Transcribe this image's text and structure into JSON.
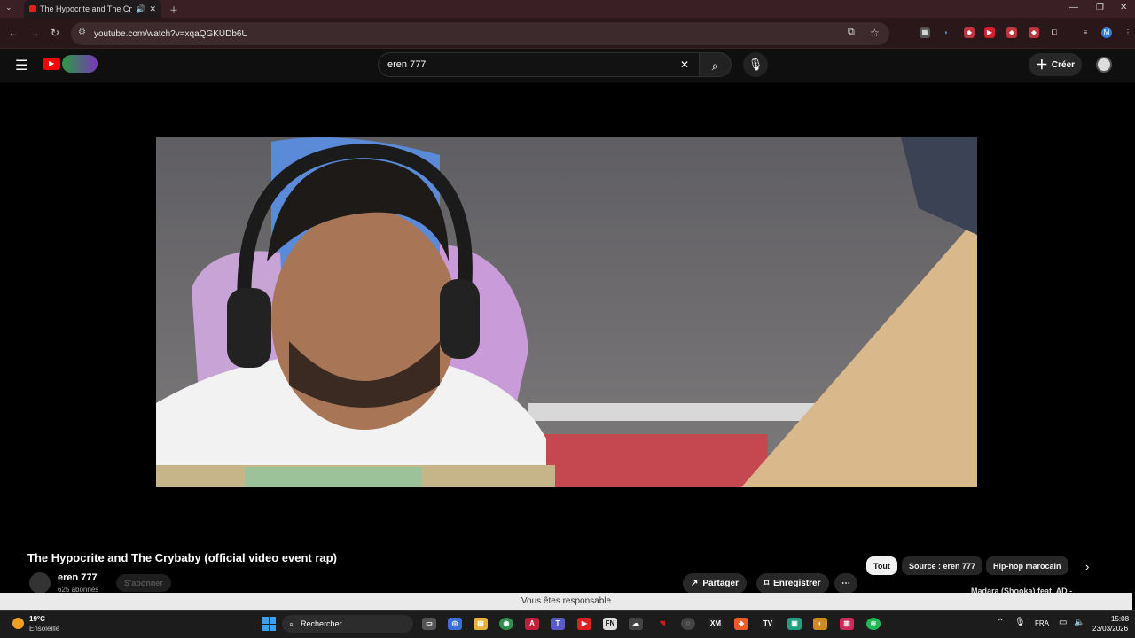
{
  "browser": {
    "tab_title": "The Hypocrite and The Cry",
    "url": "youtube.com/watch?v=xqaQGKUDb6U"
  },
  "youtube": {
    "search_value": "eren 777",
    "create_label": "Créer"
  },
  "video": {
    "title": "The Hypocrite and The Crybaby (official video event rap)",
    "channel_name": "eren 777",
    "subscribers": "625 abonnés",
    "subscribe_label": "S'abonner",
    "share_label": "Partager",
    "save_label": "Enregistrer"
  },
  "chips": [
    {
      "label": "Tout"
    },
    {
      "label": "Source : eren 777"
    },
    {
      "label": "Hip-hop marocain"
    }
  ],
  "next_video_peek": "Madara (Shooka) feat. AD -",
  "toast_text": "Vous êtes responsable",
  "taskbar": {
    "weather_temp": "19°C",
    "weather_desc": "Ensoleillé",
    "search_label": "Rechercher",
    "lang": "FRA",
    "time": "15:08",
    "date": "23/03/2026"
  },
  "colors": {
    "brand_red": "#ff0000",
    "tab_strip": "#3a1f24",
    "toolbar": "#2a1719"
  }
}
